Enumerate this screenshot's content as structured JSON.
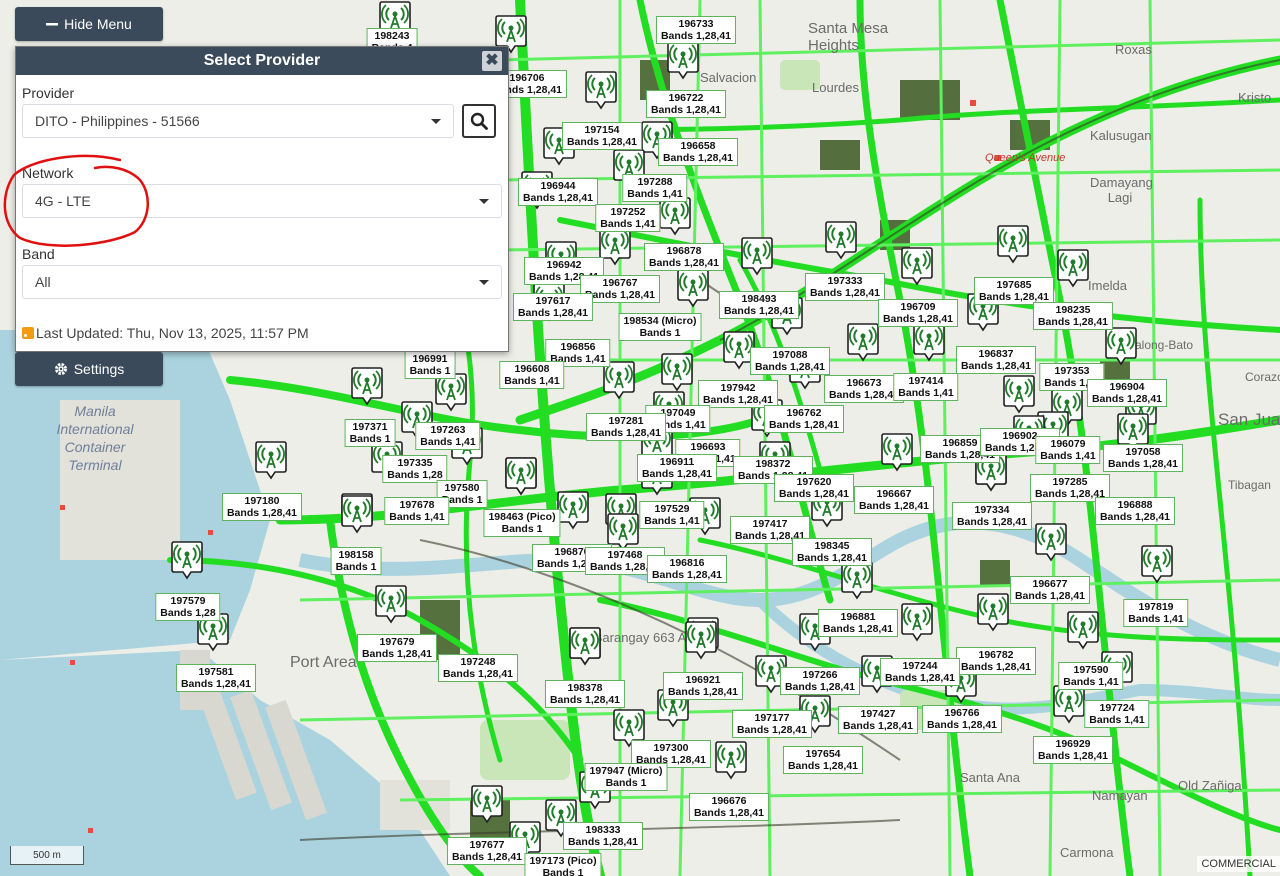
{
  "menu": {
    "hide_label": "Hide Menu",
    "settings_label": "Settings"
  },
  "panel": {
    "title": "Select Provider",
    "close_symbol": "✖",
    "provider_label": "Provider",
    "provider_value": "DITO - Philippines - 51566",
    "network_label": "Network",
    "network_value": "4G - LTE",
    "band_label": "Band",
    "band_value": "All",
    "last_updated": "Last Updated: Thu, Nov 13, 2025, 11:57 PM"
  },
  "icons": {
    "search": "search-icon",
    "minus": "minus-icon",
    "gear": "gear-icon",
    "rss": "rss-icon",
    "tower": "cell-tower-icon"
  },
  "colors": {
    "coverage": "#22dd22",
    "coverage_dark": "#3a5a20",
    "header": "#3b4b5b",
    "annotation": "#e01010",
    "label_border": "#5fb35f"
  },
  "map": {
    "scale_label": "500 m",
    "attribution": "COMMERCIAL",
    "places": [
      {
        "text": "Santa Mesa Heights",
        "size": 15
      },
      {
        "text": "Salvacion",
        "size": 13
      },
      {
        "text": "Lourdes",
        "size": 13
      },
      {
        "text": "Roxas",
        "size": 13
      },
      {
        "text": "Kristo",
        "size": 13
      },
      {
        "text": "Kalusugan",
        "size": 13
      },
      {
        "text": "Queen's Avenue",
        "size": 11
      },
      {
        "text": "Damayang Lagi",
        "size": 13
      },
      {
        "text": "Imelda",
        "size": 13
      },
      {
        "text": "Malong-Bato",
        "size": 12
      },
      {
        "text": "Corazon",
        "size": 12
      },
      {
        "text": "San Juan",
        "size": 17
      },
      {
        "text": "Tibagan",
        "size": 12
      },
      {
        "text": "Manila International Container Terminal",
        "size": 14
      },
      {
        "text": "Port Area",
        "size": 16
      },
      {
        "text": "Barangay 663 A",
        "size": 13
      },
      {
        "text": "Namayan",
        "size": 13
      },
      {
        "text": "Old Zañiga",
        "size": 13
      },
      {
        "text": "Carmona",
        "size": 13
      },
      {
        "text": "Santa Ana",
        "size": 13
      }
    ],
    "towers": [
      {
        "id": "198243",
        "bands": "Bands 4"
      },
      {
        "id": "196733",
        "bands": "Bands 1,28,41"
      },
      {
        "id": "196706",
        "bands": "Bands 1,28,41"
      },
      {
        "id": "196722",
        "bands": "Bands 1,28,41"
      },
      {
        "id": "197154",
        "bands": "Bands 1,28,41"
      },
      {
        "id": "196658",
        "bands": "Bands 1,28,41"
      },
      {
        "id": "197288",
        "bands": "Bands 1,41"
      },
      {
        "id": "196944",
        "bands": "Bands 1,28,41"
      },
      {
        "id": "197252",
        "bands": "Bands 1,41"
      },
      {
        "id": "196878",
        "bands": "Bands 1,28,41"
      },
      {
        "id": "196942",
        "bands": "Bands 1,28,41"
      },
      {
        "id": "196767",
        "bands": "Bands 1,28,41"
      },
      {
        "id": "197617",
        "bands": "Bands 1,28,41"
      },
      {
        "id": "198493",
        "bands": "Bands 1,28,41"
      },
      {
        "id": "197333",
        "bands": "Bands 1,28,41"
      },
      {
        "id": "197685",
        "bands": "Bands 1,28,41"
      },
      {
        "id": "196709",
        "bands": "Bands 1,28,41"
      },
      {
        "id": "198235",
        "bands": "Bands 1,28,41"
      },
      {
        "id": "198534 (Micro)",
        "bands": "Bands 1"
      },
      {
        "id": "196856",
        "bands": "Bands 1,41"
      },
      {
        "id": "196991",
        "bands": "Bands 1"
      },
      {
        "id": "196608",
        "bands": "Bands 1,41"
      },
      {
        "id": "197088",
        "bands": "Bands 1,28,41"
      },
      {
        "id": "196837",
        "bands": "Bands 1,28,41"
      },
      {
        "id": "197353",
        "bands": "Bands 1,41"
      },
      {
        "id": "196673",
        "bands": "Bands 1,28,41"
      },
      {
        "id": "197414",
        "bands": "Bands 1,41"
      },
      {
        "id": "196904",
        "bands": "Bands 1,28,41"
      },
      {
        "id": "197942",
        "bands": "Bands 1,28,41"
      },
      {
        "id": "197049",
        "bands": "Bands 1,41"
      },
      {
        "id": "197281",
        "bands": "Bands 1,28,41"
      },
      {
        "id": "196762",
        "bands": "Bands 1,28,41"
      },
      {
        "id": "197371",
        "bands": "Bands 1"
      },
      {
        "id": "197263",
        "bands": "Bands 1,41"
      },
      {
        "id": "196693",
        "bands": "Bands 1,41"
      },
      {
        "id": "196859",
        "bands": "Bands 1,28,41"
      },
      {
        "id": "196902",
        "bands": "Bands 1,28,41"
      },
      {
        "id": "196079",
        "bands": "Bands 1,41"
      },
      {
        "id": "197058",
        "bands": "Bands 1,28,41"
      },
      {
        "id": "197335",
        "bands": "Bands 1,28"
      },
      {
        "id": "196911",
        "bands": "Bands 1,28,41"
      },
      {
        "id": "198372",
        "bands": "Bands 1,28,41"
      },
      {
        "id": "197580",
        "bands": "Bands 1"
      },
      {
        "id": "197620",
        "bands": "Bands 1,28,41"
      },
      {
        "id": "196667",
        "bands": "Bands 1,28,41"
      },
      {
        "id": "197285",
        "bands": "Bands 1,28,41"
      },
      {
        "id": "197180",
        "bands": "Bands 1,28,41"
      },
      {
        "id": "197678",
        "bands": "Bands 1,41"
      },
      {
        "id": "198463 (Pico)",
        "bands": "Bands 1"
      },
      {
        "id": "197529",
        "bands": "Bands 1,41"
      },
      {
        "id": "197334",
        "bands": "Bands 1,28,41"
      },
      {
        "id": "196888",
        "bands": "Bands 1,28,41"
      },
      {
        "id": "197417",
        "bands": "Bands 1,28,41"
      },
      {
        "id": "198345",
        "bands": "Bands 1,28,41"
      },
      {
        "id": "198158",
        "bands": "Bands 1"
      },
      {
        "id": "196870",
        "bands": "Bands 1,28,41"
      },
      {
        "id": "197468",
        "bands": "Bands 1,28,41"
      },
      {
        "id": "196816",
        "bands": "Bands 1,28,41"
      },
      {
        "id": "196677",
        "bands": "Bands 1,28,41"
      },
      {
        "id": "197579",
        "bands": "Bands 1,28"
      },
      {
        "id": "197819",
        "bands": "Bands 1,41"
      },
      {
        "id": "196881",
        "bands": "Bands 1,28,41"
      },
      {
        "id": "197679",
        "bands": "Bands 1,28,41"
      },
      {
        "id": "197248",
        "bands": "Bands 1,28,41"
      },
      {
        "id": "196782",
        "bands": "Bands 1,28,41"
      },
      {
        "id": "197244",
        "bands": "Bands 1,28,41"
      },
      {
        "id": "197581",
        "bands": "Bands 1,28,41"
      },
      {
        "id": "197266",
        "bands": "Bands 1,28,41"
      },
      {
        "id": "197590",
        "bands": "Bands 1,41"
      },
      {
        "id": "198378",
        "bands": "Bands 1,28,41"
      },
      {
        "id": "196921",
        "bands": "Bands 1,28,41"
      },
      {
        "id": "197177",
        "bands": "Bands 1,28,41"
      },
      {
        "id": "197427",
        "bands": "Bands 1,28,41"
      },
      {
        "id": "196766",
        "bands": "Bands 1,28,41"
      },
      {
        "id": "197724",
        "bands": "Bands 1,41"
      },
      {
        "id": "197300",
        "bands": "Bands 1,28,41"
      },
      {
        "id": "197654",
        "bands": "Bands 1,28,41"
      },
      {
        "id": "196929",
        "bands": "Bands 1,28,41"
      },
      {
        "id": "197947 (Micro)",
        "bands": "Bands 1"
      },
      {
        "id": "196676",
        "bands": "Bands 1,28,41"
      },
      {
        "id": "198333",
        "bands": "Bands 1,28,41"
      },
      {
        "id": "197677",
        "bands": "Bands 1,28,41"
      },
      {
        "id": "197173 (Pico)",
        "bands": "Bands 1"
      }
    ]
  }
}
